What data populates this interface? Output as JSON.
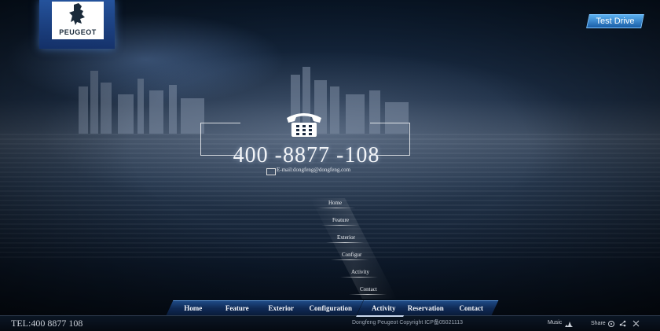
{
  "brand": {
    "name": "PEUGEOT",
    "logo_icon": "peugeot-lion-icon"
  },
  "header": {
    "test_drive_label": "Test Drive"
  },
  "contact": {
    "phone": "400 -8877 -108",
    "email": "E-mail:dongfeng@dongfeng.com",
    "phone_icon": "telephone-icon",
    "email_icon": "envelope-icon"
  },
  "diagonal_menu": {
    "items": [
      "Home",
      "Feature",
      "Exterior",
      "Configur",
      "Activity",
      "Contact"
    ]
  },
  "nav": {
    "tabs": [
      "Home",
      "Feature",
      "Exterior",
      "Configuration",
      "Activity",
      "Reservation",
      "Contact"
    ],
    "active": "Activity"
  },
  "footer": {
    "tel": "TEL:400 8877 108",
    "copyright": "Dongfeng Peugeot   Copyright ICP备05021113",
    "music_label": "Music",
    "share_label": "Share"
  },
  "colors": {
    "accent": "#1f4a86",
    "test_drive": "#2a7bd0"
  }
}
